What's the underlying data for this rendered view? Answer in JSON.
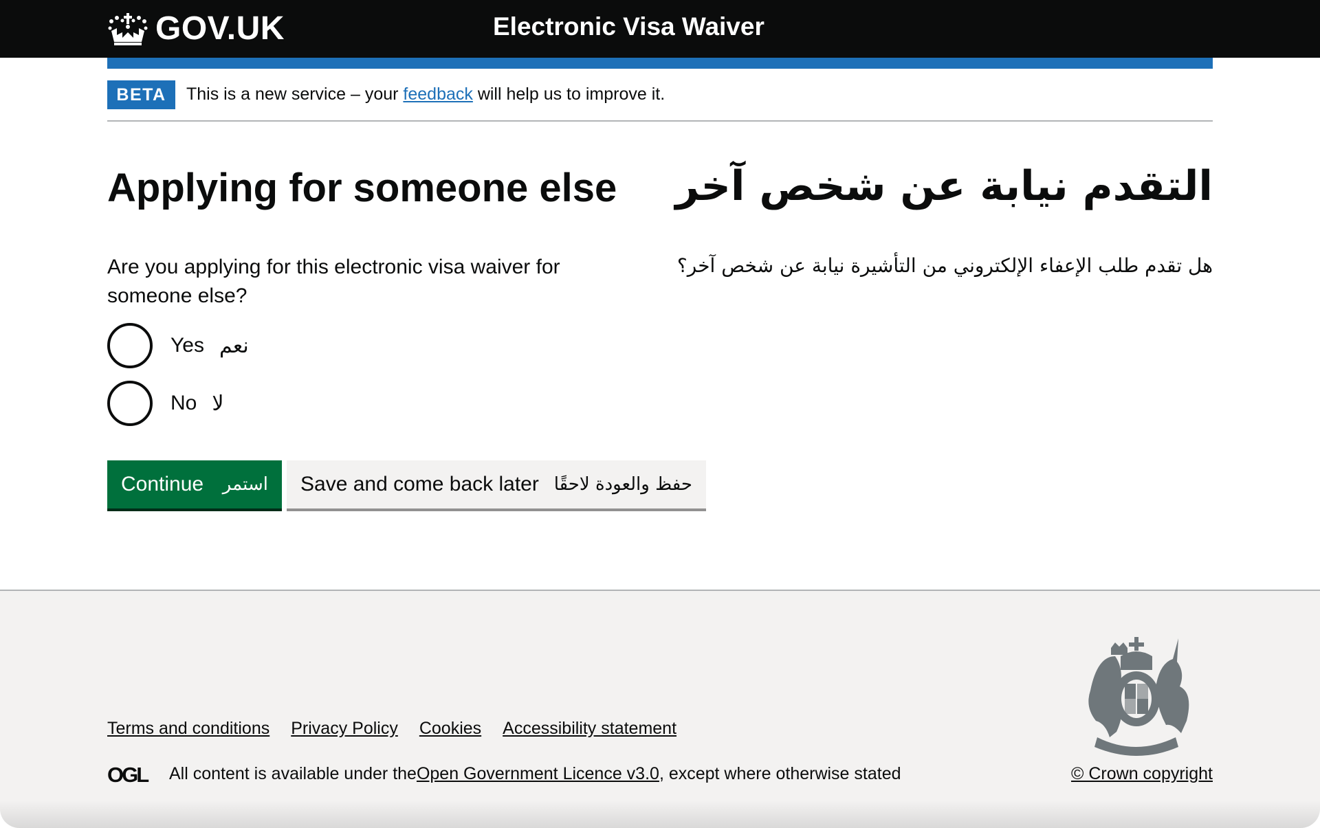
{
  "header": {
    "logo_text": "GOV.UK",
    "logo_icon": "crown-icon",
    "service_name": "Electronic Visa Waiver"
  },
  "phase_banner": {
    "tag": "BETA",
    "text_before": "This is a new service – your ",
    "link": "feedback",
    "text_after": " will help us to improve it."
  },
  "page": {
    "heading_en": "Applying for someone else",
    "heading_ar": "التقدم نيابة عن شخص آخر",
    "question_en": "Are you applying for this electronic visa waiver for someone else?",
    "question_ar": "هل تقدم طلب الإعفاء الإلكتروني من التأشيرة نيابة عن شخص آخر؟",
    "options": [
      {
        "label_en": "Yes",
        "label_ar": "نعم",
        "selected": false
      },
      {
        "label_en": "No",
        "label_ar": "لا",
        "selected": false
      }
    ]
  },
  "actions": {
    "continue_en": "Continue",
    "continue_ar": "استمر",
    "save_en": "Save and come back later",
    "save_ar": "حفظ والعودة لاحقًا",
    "colors": {
      "primary": "#00703c",
      "secondary": "#f3f2f1",
      "brand": "#1d70b8"
    }
  },
  "footer": {
    "links": [
      "Terms and conditions",
      "Privacy Policy",
      "Cookies",
      "Accessibility statement"
    ],
    "licence_logo": "OGL",
    "licence_before": "All content is available under the ",
    "licence_link": "Open Government Licence v3.0",
    "licence_after": ", except where otherwise stated",
    "copyright": "© Crown copyright",
    "crest_icon": "royal-coat-of-arms-icon"
  }
}
